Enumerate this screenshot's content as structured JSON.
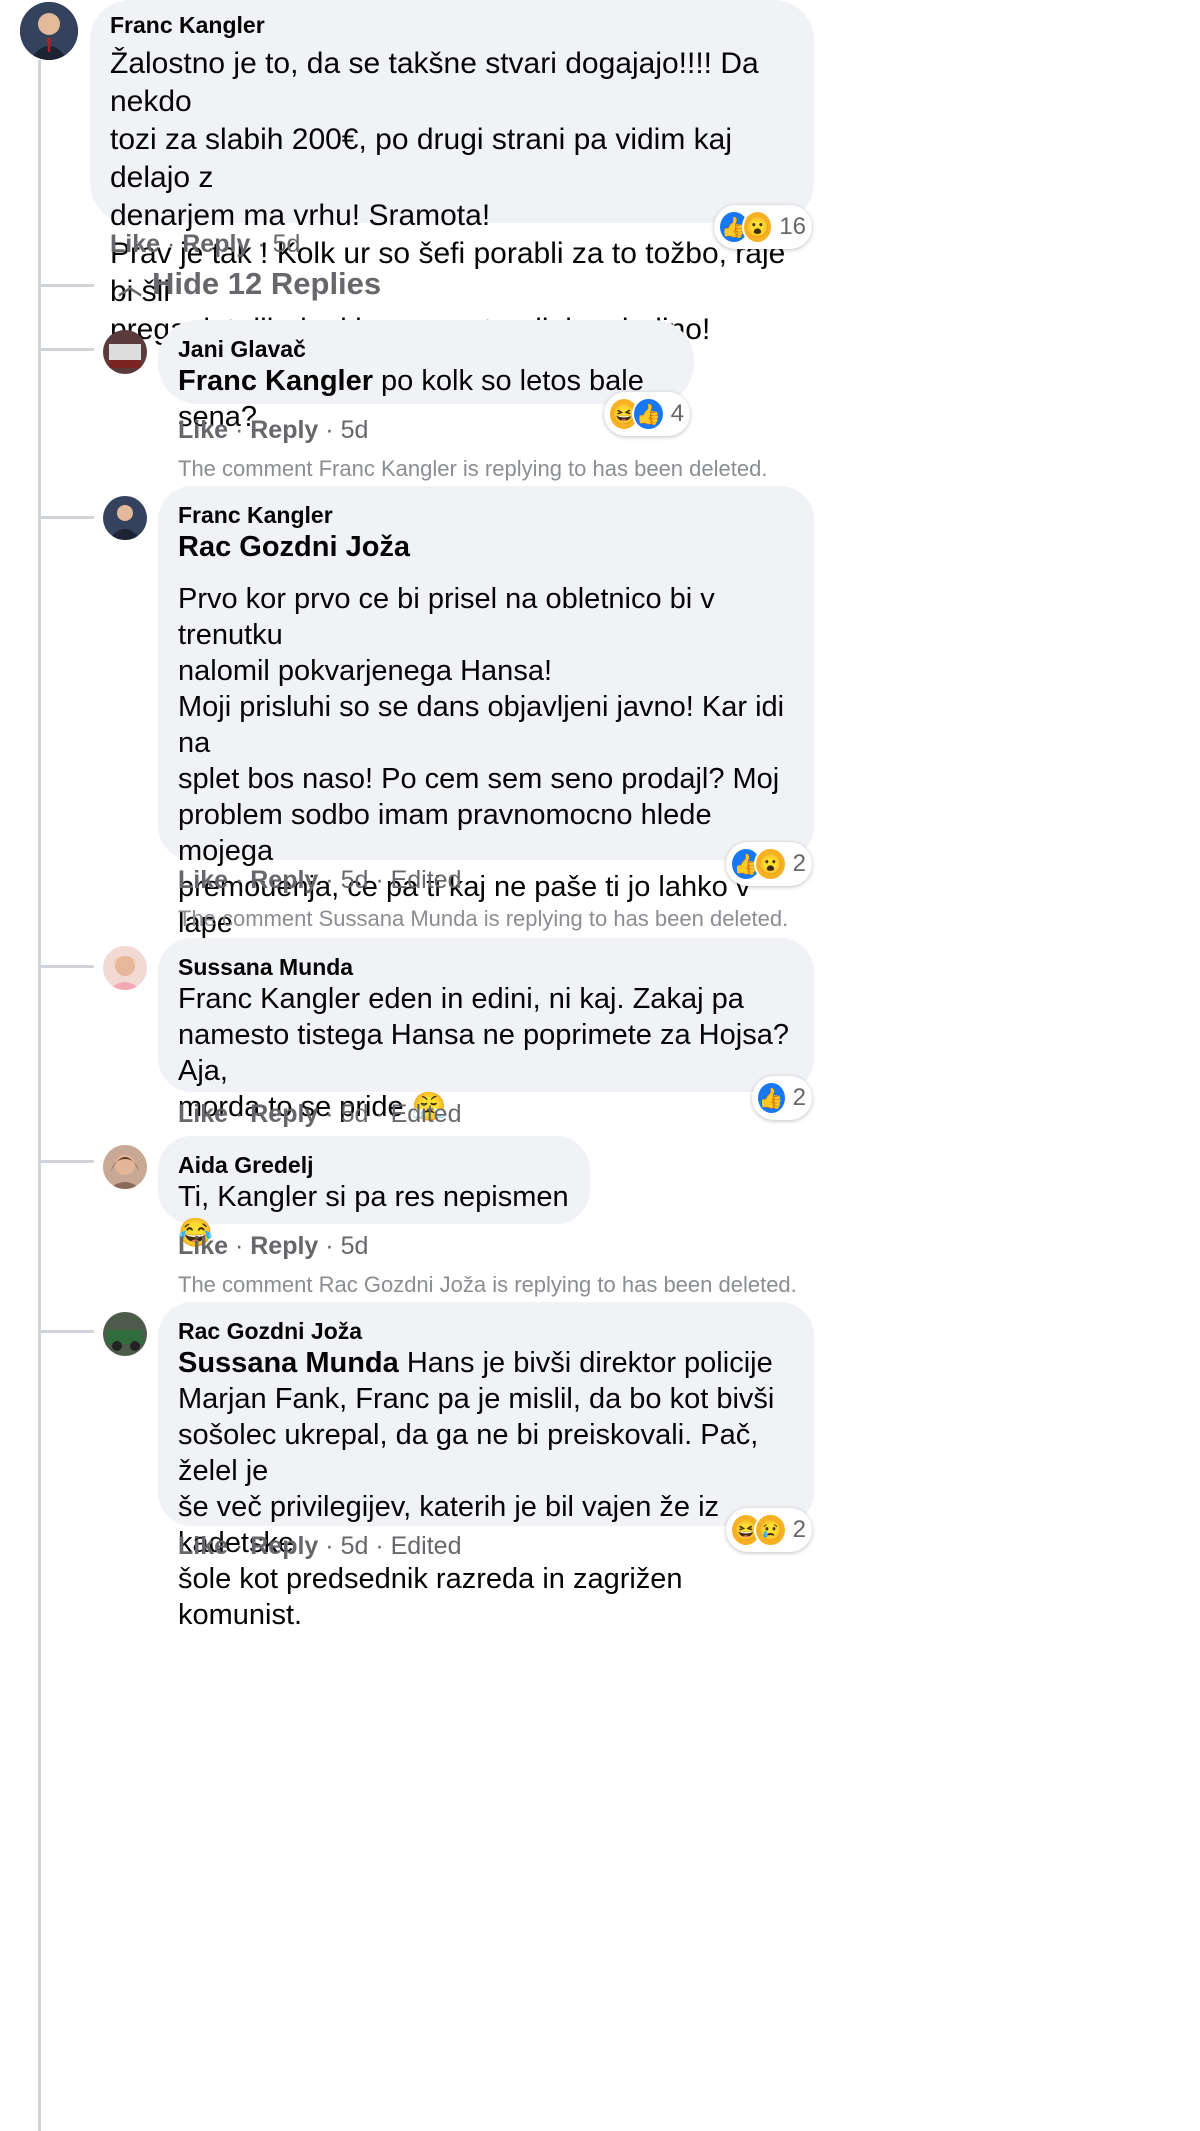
{
  "main_comment": {
    "author": "Franc Kangler",
    "text": "Žalostno je to, da se takšne stvari dogajajo!!!! Da nekdo\ntozi za slabih 200€, po drugi strani pa vidim kaj delajo z\ndenarjem ma vrhu! Sramota!\nPrav je tak ! Kolk ur so šefi porabli za to tožbo, raje bi šli\npreganjat dilerje, ki nam zastrupljajo mladino!",
    "like": "Like",
    "reply": "Reply",
    "time": "5d",
    "reaction_icons": [
      "like-icon",
      "wow-icon"
    ],
    "reaction_count": "16"
  },
  "hide_replies_label": "Hide 12 Replies",
  "replies": [
    {
      "author": "Jani Glavač",
      "tag": "Franc Kangler",
      "text": " po kolk so letos bale sena?",
      "like": "Like",
      "reply": "Reply",
      "time": "5d",
      "edited": "",
      "reaction_icons": [
        "haha-icon",
        "like-icon"
      ],
      "reaction_count": "4"
    },
    {
      "deleted_notice": "The comment Franc Kangler is replying to has been deleted.",
      "author": "Franc Kangler",
      "tag": "Rac Gozdni Joža",
      "text": "Prvo kor prvo ce bi prisel na obletnico bi v trenutku\nnalomil pokvarjenega Hansa!\nMoji prisluhi so se dans objavljeni javno! Kar idi na\nsplet bos naso! Po cem sem seno prodajl? Moj\nproblem sodbo imam pravnomocno hlede mojega\npremouenja, ce pa ti kaj ne paše ti jo lahko v lape\nzabijem za vse vecne čase! Mogoce bi te v Tacnu\nmoral vredu nalomit, pa si nisem hotel mazat rok !",
      "like": "Like",
      "reply": "Reply",
      "time": "5d",
      "edited": "Edited",
      "reaction_icons": [
        "like-icon",
        "wow-icon"
      ],
      "reaction_count": "2"
    },
    {
      "deleted_notice": "The comment Sussana Munda is replying to has been deleted.",
      "author": "Sussana Munda",
      "text": "Franc Kangler eden in edini, ni kaj. Zakaj pa\nnamesto tistega Hansa ne poprimete za Hojsa? Aja,\nmorda to se pride ",
      "emoji": "😤",
      "like": "Like",
      "reply": "Reply",
      "time": "5d",
      "edited": "Edited",
      "reaction_icons": [
        "like-icon"
      ],
      "reaction_count": "2"
    },
    {
      "author": "Aida Gredelj",
      "text": "Ti, Kangler si pa res nepismen ",
      "emoji": "😂",
      "like": "Like",
      "reply": "Reply",
      "time": "5d",
      "edited": ""
    },
    {
      "deleted_notice": "The comment Rac Gozdni Joža is replying to has been deleted.",
      "author": "Rac Gozdni Joža",
      "tag": "Sussana Munda",
      "text": " Hans je bivši direktor policije\nMarjan Fank, Franc pa je mislil, da bo kot bivši\nsošolec ukrepal, da ga ne bi preiskovali. Pač, želel je\nše več privilegijev, katerih je bil vajen že iz kadetske\nšole kot predsednik razreda in zagrižen komunist.",
      "like": "Like",
      "reply": "Reply",
      "time": "5d",
      "edited": "Edited",
      "reaction_icons": [
        "haha-icon",
        "sad-icon"
      ],
      "reaction_count": "2"
    }
  ],
  "separator": " · "
}
